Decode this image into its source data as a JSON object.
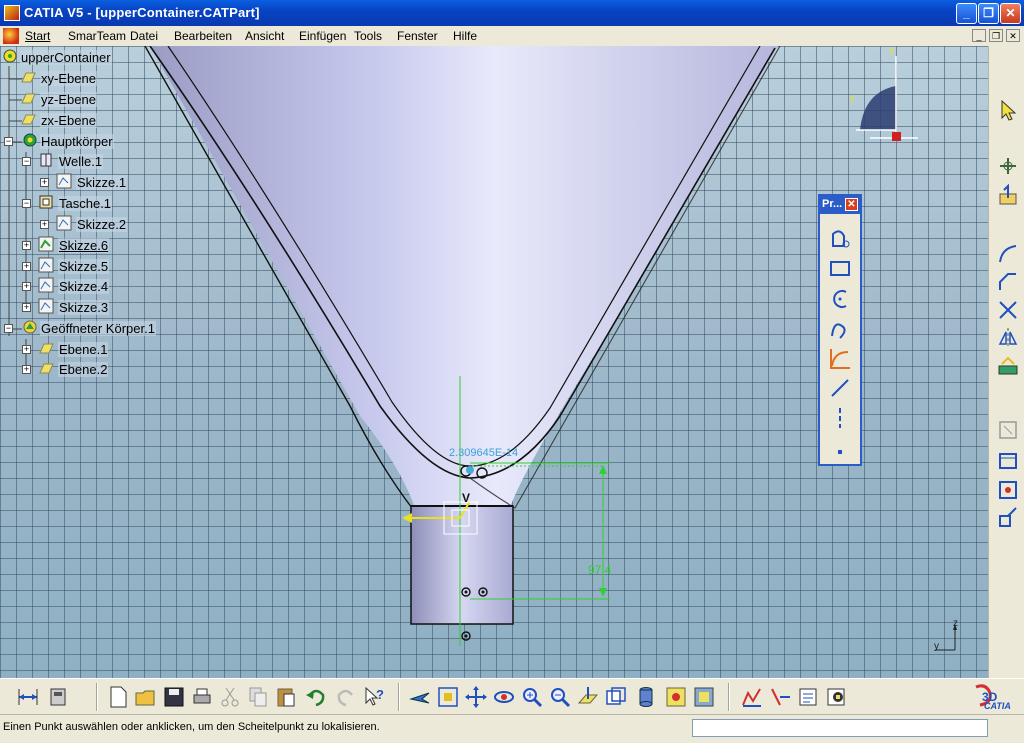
{
  "window": {
    "title": "CATIA V5 - [upperContainer.CATPart]",
    "buttons": {
      "minimize": "_",
      "maximize": "❐",
      "close": "✕"
    }
  },
  "menubar": {
    "items": [
      "Start",
      "SmarTeam",
      "Datei",
      "Bearbeiten",
      "Ansicht",
      "Einfügen",
      "Tools",
      "Fenster",
      "Hilfe"
    ],
    "mdi_buttons": {
      "minimize": "_",
      "restore": "❐",
      "close": "✕"
    }
  },
  "tree": [
    {
      "label": "upperContainer",
      "icon": "part-icon"
    },
    {
      "label": "xy-Ebene",
      "icon": "plane-icon"
    },
    {
      "label": "yz-Ebene",
      "icon": "plane-icon"
    },
    {
      "label": "zx-Ebene",
      "icon": "plane-icon"
    },
    {
      "label": "Hauptkörper",
      "icon": "body-icon"
    },
    {
      "label": "Welle.1",
      "icon": "shaft-icon"
    },
    {
      "label": "Skizze.1",
      "icon": "sketch-icon"
    },
    {
      "label": "Tasche.1",
      "icon": "pocket-icon"
    },
    {
      "label": "Skizze.2",
      "icon": "sketch-icon"
    },
    {
      "label": "Skizze.6",
      "icon": "sketch-active-icon"
    },
    {
      "label": "Skizze.5",
      "icon": "sketch-icon"
    },
    {
      "label": "Skizze.4",
      "icon": "sketch-icon"
    },
    {
      "label": "Skizze.3",
      "icon": "sketch-icon"
    },
    {
      "label": "Geöffneter Körper.1",
      "icon": "open-body-icon"
    },
    {
      "label": "Ebene.1",
      "icon": "plane-icon"
    },
    {
      "label": "Ebene.2",
      "icon": "plane-icon"
    }
  ],
  "viewport": {
    "dimension_label": "97.4",
    "coord_label": "2.309645E-14",
    "v_axis_label": "V",
    "compass": {
      "y": "y",
      "z": "z"
    },
    "triad": {
      "y": "y",
      "z": "z"
    }
  },
  "profile_toolbar": {
    "title": "Pr...",
    "close": "✕",
    "tools": [
      "profile-icon",
      "rectangle-icon",
      "circle-icon",
      "spline-icon",
      "conic-icon",
      "line-icon",
      "axis-icon",
      "point-icon"
    ]
  },
  "right_toolbar": {
    "tools": [
      "select-arrow-icon",
      "sketch-tool-icon",
      "exit-workbench-icon",
      "corner-icon",
      "chamfer-icon",
      "trim-icon",
      "mirror-icon",
      "project-icon",
      "constraint-icon",
      "fix-icon",
      "animate-icon",
      "auto-constraint-icon"
    ]
  },
  "bottom_toolbar": {
    "tools": [
      "dimension-icon",
      "catalog-icon",
      "new-file-icon",
      "open-file-icon",
      "save-icon",
      "print-icon",
      "cut-icon",
      "copy-icon",
      "paste-icon",
      "undo-icon",
      "redo-icon",
      "whats-this-icon",
      "fly-icon",
      "fit-all-icon",
      "pan-icon",
      "rotate-icon",
      "zoom-in-icon",
      "zoom-out-icon",
      "normal-view-icon",
      "views-icon",
      "render-style-icon",
      "hide-show-icon",
      "swap-space-icon",
      "analysis-icon",
      "cut-part-icon",
      "sketch-analysis-icon",
      "grid-icon"
    ]
  },
  "status": {
    "message": "Einen Punkt auswählen oder anklicken, um den Scheitelpunkt zu lokalisieren.",
    "command_input": ""
  },
  "brand": {
    "logo_text": "CATIA"
  }
}
